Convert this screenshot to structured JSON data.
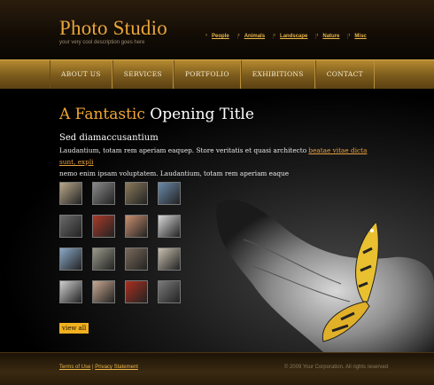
{
  "header": {
    "logo": "Photo Studio",
    "tagline": "your very cool description goes here",
    "links": [
      "People",
      "Animals",
      "Landscape",
      "Nature",
      "Misc"
    ]
  },
  "nav": [
    "ABOUT US",
    "SERVICES",
    "PORTFOLIO",
    "EXHIBITIONS",
    "CONTACT"
  ],
  "main": {
    "title_hl": "A Fantastic",
    "title_rest": "Opening Title",
    "subtitle": "Sed diamaccusantium",
    "para_1": "Laudantium, totam rem aperiam eaquep. Store veritatis et quasi architecto ",
    "para_link": "beatae vitae dicta sunt, expli",
    "para_2": "nemo enim ipsam voluptatem. Laudantium, totam rem aperiam eaque",
    "view_all": "view all"
  },
  "thumbnails": [
    {
      "name": "thumb-dog",
      "color": "#b8a88a"
    },
    {
      "name": "thumb-man",
      "color": "#8a8a8a"
    },
    {
      "name": "thumb-boy",
      "color": "#8a7a5a"
    },
    {
      "name": "thumb-sky",
      "color": "#6a8aaa"
    },
    {
      "name": "thumb-car",
      "color": "#6a6a6a"
    },
    {
      "name": "thumb-kid",
      "color": "#aa3a2a"
    },
    {
      "name": "thumb-couple",
      "color": "#c89070"
    },
    {
      "name": "thumb-eye",
      "color": "#d8d8d8"
    },
    {
      "name": "thumb-mountain",
      "color": "#8aa8c8"
    },
    {
      "name": "thumb-field",
      "color": "#9a9a8a"
    },
    {
      "name": "thumb-face",
      "color": "#7a6a5a"
    },
    {
      "name": "thumb-sheep",
      "color": "#c8c0b0"
    },
    {
      "name": "thumb-eye2",
      "color": "#cfcfcf"
    },
    {
      "name": "thumb-woman",
      "color": "#c8a890"
    },
    {
      "name": "thumb-girl",
      "color": "#aa3020"
    },
    {
      "name": "thumb-stones",
      "color": "#7a7a7a"
    }
  ],
  "footer": {
    "terms": "Terms of Use",
    "sep": " | ",
    "privacy": "Privacy Statement",
    "copyright": "© 2009 Your Corporation. All rights reserved"
  }
}
